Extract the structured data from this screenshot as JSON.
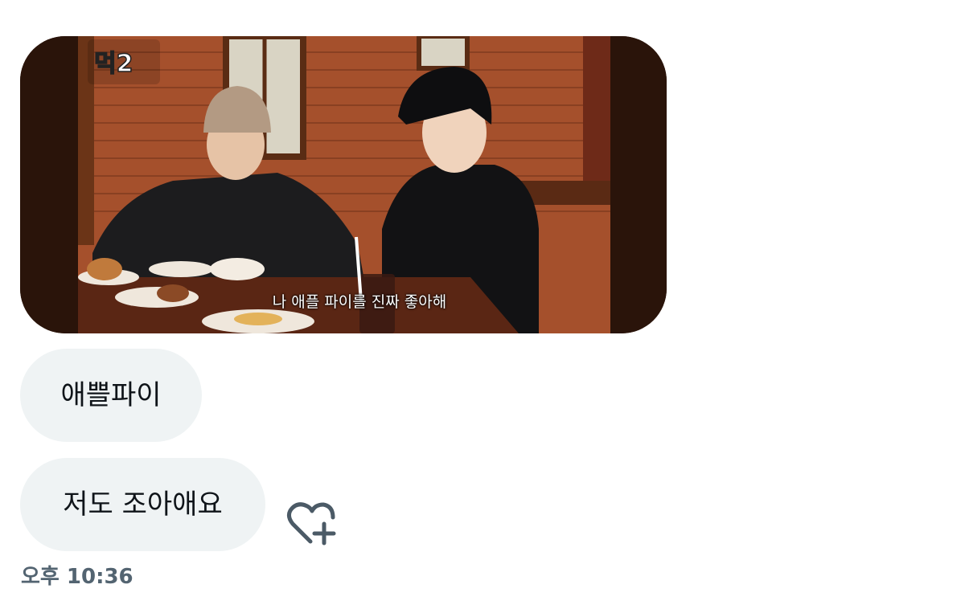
{
  "media": {
    "show_logo": "먹2",
    "subtitle": "나 애플 파이를 진짜 좋아해"
  },
  "messages": [
    {
      "text": "애쁠파이"
    },
    {
      "text": "저도 조아애요"
    }
  ],
  "reaction_icon": "heart-plus-icon",
  "timestamp": "오후 10:36"
}
